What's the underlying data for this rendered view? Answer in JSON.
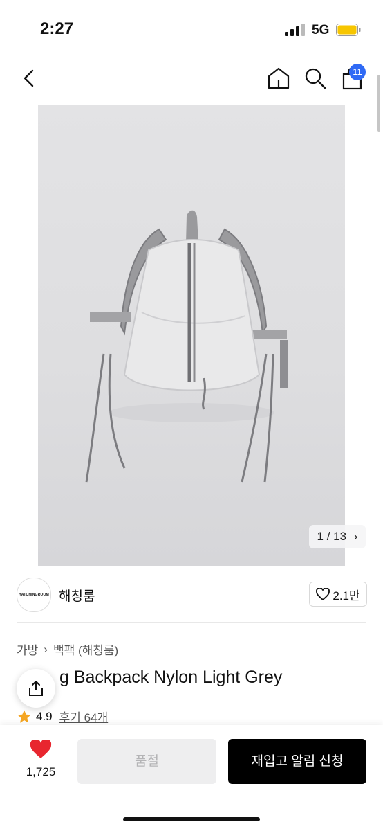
{
  "status_bar": {
    "time": "2:27",
    "network": "5G",
    "battery_color": "#f7c600"
  },
  "header": {
    "cart_count": "11",
    "badge_color": "#2f6af5"
  },
  "gallery": {
    "counter": "1 / 13"
  },
  "brand": {
    "logo_text": "HATCHINGROOM",
    "name": "해칭룸",
    "likes": "2.1만"
  },
  "breadcrumb": {
    "category": "가방",
    "subcategory": "백팩 (해칭룸)"
  },
  "product": {
    "title_visible": "g Backpack Nylon Light Grey",
    "rating": "4.9",
    "reviews": "후기 64개",
    "star_color": "#f5a623"
  },
  "bottom_bar": {
    "wish_count": "1,725",
    "soldout_label": "품절",
    "restock_label": "재입고 알림 신청",
    "heart_color": "#e8262f"
  }
}
